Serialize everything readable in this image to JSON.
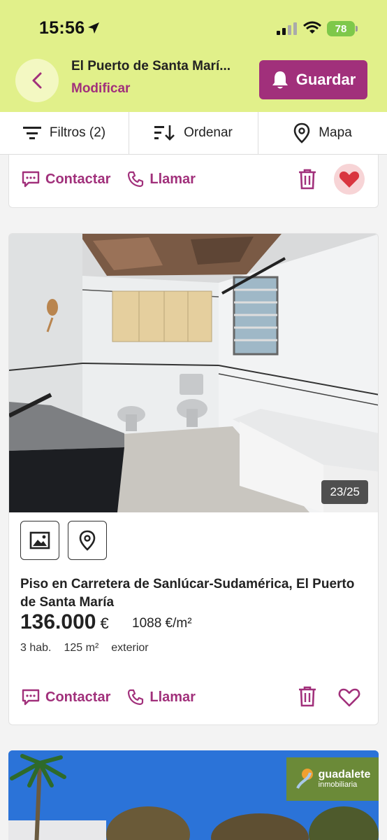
{
  "status_bar": {
    "time": "15:56",
    "battery": "78"
  },
  "header": {
    "location": "El Puerto de Santa Marí...",
    "modify_label": "Modificar",
    "save_label": "Guardar",
    "accent_color": "#a1307b",
    "header_color": "#e1f08a"
  },
  "toolbar": {
    "filters_label": "Filtros (2)",
    "sort_label": "Ordenar",
    "map_label": "Mapa"
  },
  "card_prev": {
    "contact_label": "Contactar",
    "call_label": "Llamar",
    "favorited": true
  },
  "listing": {
    "photo_counter": "23/25",
    "title": "Piso en Carretera de Sanlúcar-Sudamérica, El Puerto de Santa María",
    "price": "136.000",
    "currency": "€",
    "price_per_m2": "1088 €/m²",
    "features": [
      "3 hab.",
      "125 m²",
      "exterior"
    ],
    "contact_label": "Contactar",
    "call_label": "Llamar",
    "favorited": false
  },
  "next_listing": {
    "agency_name": "guadalete",
    "agency_sub": "inmobiliaria"
  }
}
